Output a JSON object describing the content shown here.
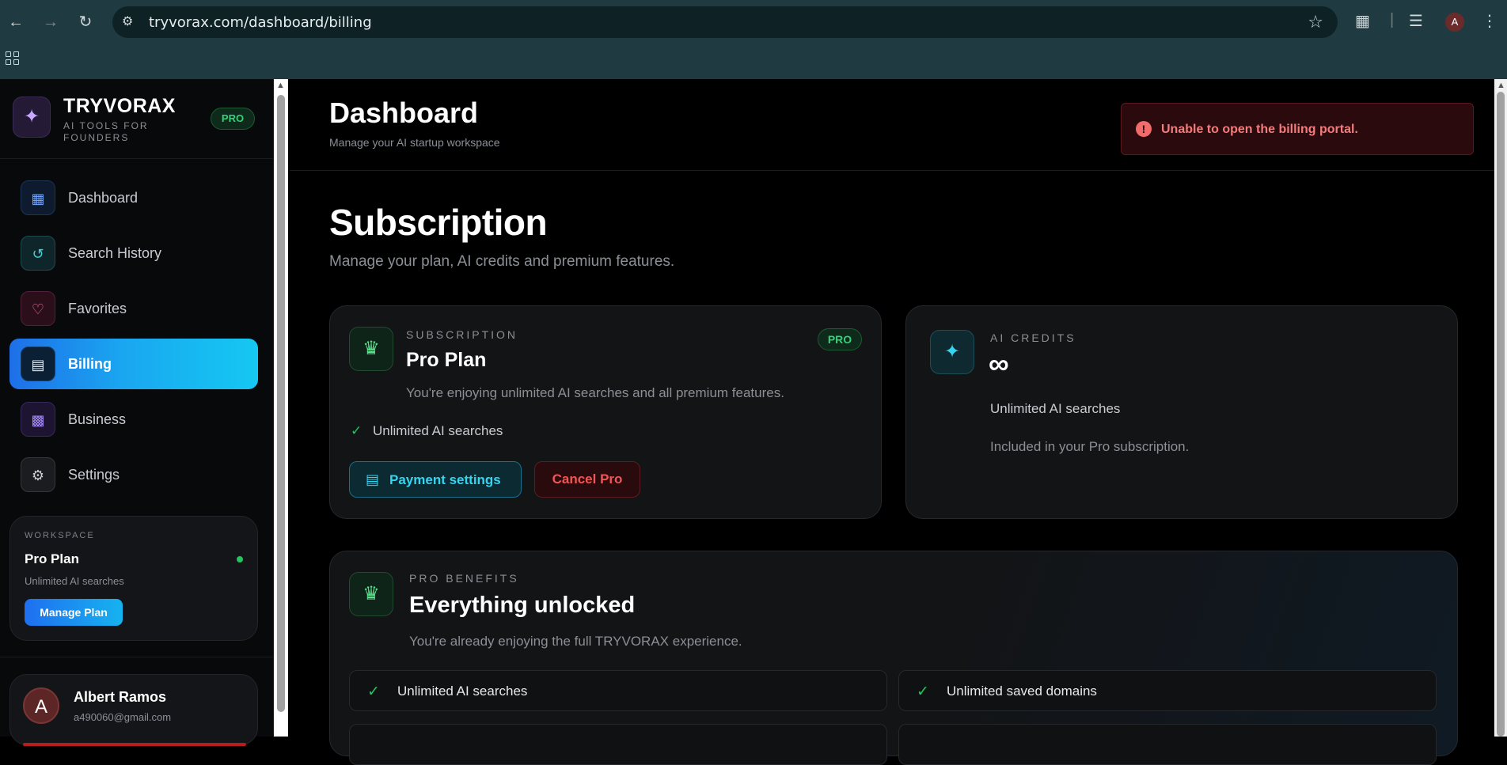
{
  "browser": {
    "url": "tryvorax.com/dashboard/billing",
    "profile_initial": "A"
  },
  "sidebar": {
    "brand_name": "TRYVORAX",
    "brand_tagline": "AI TOOLS FOR FOUNDERS",
    "brand_badge": "PRO",
    "items": [
      {
        "label": "Dashboard",
        "icon": "grid-icon",
        "active": false
      },
      {
        "label": "Search History",
        "icon": "history-icon",
        "active": false
      },
      {
        "label": "Favorites",
        "icon": "heart-icon",
        "active": false
      },
      {
        "label": "Billing",
        "icon": "credit-card-icon",
        "active": true
      },
      {
        "label": "Business",
        "icon": "bar-chart-icon",
        "active": false
      },
      {
        "label": "Settings",
        "icon": "gear-icon",
        "active": false
      }
    ],
    "workspace": {
      "label": "WORKSPACE",
      "plan": "Pro Plan",
      "description": "Unlimited AI searches",
      "button": "Manage Plan"
    },
    "user": {
      "initial": "A",
      "name": "Albert Ramos",
      "email": "a490060@gmail.com"
    }
  },
  "header": {
    "title": "Dashboard",
    "subtitle": "Manage your AI startup workspace"
  },
  "toast": {
    "message": "Unable to open the billing portal.",
    "icon": "!"
  },
  "page": {
    "title": "Subscription",
    "subtitle": "Manage your plan, AI credits and premium features."
  },
  "subscription_card": {
    "label": "SUBSCRIPTION",
    "plan": "Pro Plan",
    "badge": "PRO",
    "description": "You're enjoying unlimited AI searches and all premium features.",
    "feature": "Unlimited AI searches",
    "payment_button": "Payment settings",
    "cancel_button": "Cancel Pro"
  },
  "credits_card": {
    "label": "AI CREDITS",
    "value": "∞",
    "description": "Unlimited AI searches",
    "note": "Included in your Pro subscription."
  },
  "benefits_card": {
    "label": "PRO BENEFITS",
    "title": "Everything unlocked",
    "description": "You're already enjoying the full TRYVORAX experience.",
    "items": [
      "Unlimited AI searches",
      "Unlimited saved domains"
    ]
  },
  "colors": {
    "accent": "#1aa6f0",
    "success": "#22c55e",
    "danger": "#f25555"
  }
}
